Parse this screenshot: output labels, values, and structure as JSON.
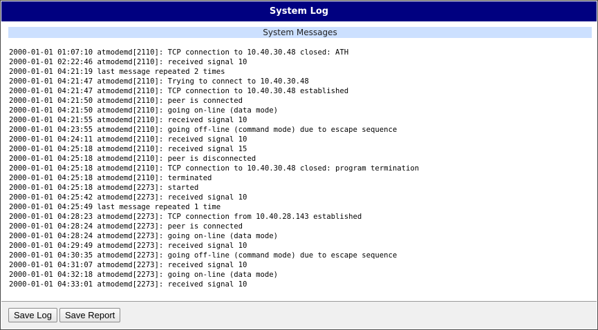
{
  "window": {
    "title": "System Log"
  },
  "section": {
    "header": "System Messages"
  },
  "log": {
    "lines": [
      "2000-01-01 01:07:10 atmodemd[2110]: TCP connection to 10.40.30.48 closed: ATH",
      "2000-01-01 02:22:46 atmodemd[2110]: received signal 10",
      "2000-01-01 04:21:19 last message repeated 2 times",
      "2000-01-01 04:21:47 atmodemd[2110]: Trying to connect to 10.40.30.48",
      "2000-01-01 04:21:47 atmodemd[2110]: TCP connection to 10.40.30.48 established",
      "2000-01-01 04:21:50 atmodemd[2110]: peer is connected",
      "2000-01-01 04:21:50 atmodemd[2110]: going on-line (data mode)",
      "2000-01-01 04:21:55 atmodemd[2110]: received signal 10",
      "2000-01-01 04:23:55 atmodemd[2110]: going off-line (command mode) due to escape sequence",
      "2000-01-01 04:24:11 atmodemd[2110]: received signal 10",
      "2000-01-01 04:25:18 atmodemd[2110]: received signal 15",
      "2000-01-01 04:25:18 atmodemd[2110]: peer is disconnected",
      "2000-01-01 04:25:18 atmodemd[2110]: TCP connection to 10.40.30.48 closed: program termination",
      "2000-01-01 04:25:18 atmodemd[2110]: terminated",
      "2000-01-01 04:25:18 atmodemd[2273]: started",
      "2000-01-01 04:25:42 atmodemd[2273]: received signal 10",
      "2000-01-01 04:25:49 last message repeated 1 time",
      "2000-01-01 04:28:23 atmodemd[2273]: TCP connection from 10.40.28.143 established",
      "2000-01-01 04:28:24 atmodemd[2273]: peer is connected",
      "2000-01-01 04:28:24 atmodemd[2273]: going on-line (data mode)",
      "2000-01-01 04:29:49 atmodemd[2273]: received signal 10",
      "2000-01-01 04:30:35 atmodemd[2273]: going off-line (command mode) due to escape sequence",
      "2000-01-01 04:31:07 atmodemd[2273]: received signal 10",
      "2000-01-01 04:32:18 atmodemd[2273]: going on-line (data mode)",
      "2000-01-01 04:33:01 atmodemd[2273]: received signal 10"
    ]
  },
  "footer": {
    "save_log_label": "Save Log",
    "save_report_label": "Save Report"
  },
  "colors": {
    "title_bar": "#000080",
    "section_header": "#cce0ff",
    "footer": "#f0f0f0"
  }
}
